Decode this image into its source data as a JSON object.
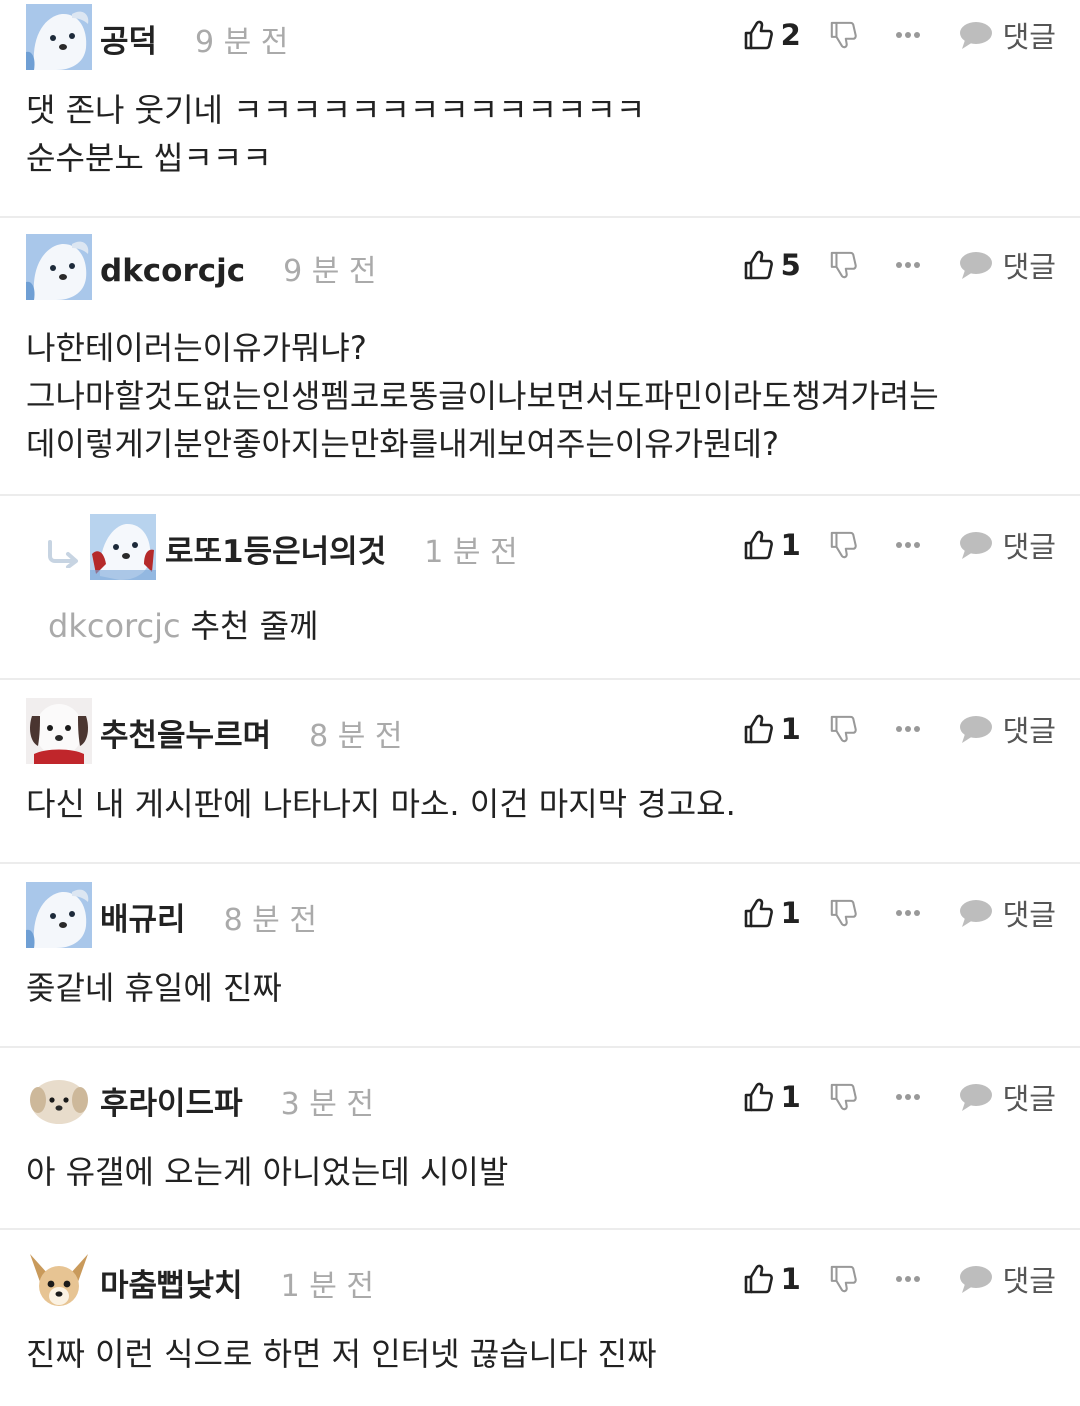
{
  "actions": {
    "reply_label": "댓글"
  },
  "comments": [
    {
      "author": "공덕",
      "time": "9 분 전",
      "likes": "2",
      "avatar": "white-dog-avatar",
      "lines": [
        "댓 존나 웃기네 ㅋㅋㅋㅋㅋㅋㅋㅋㅋㅋㅋㅋㅋㅋ",
        "순수분노 씹ㅋㅋㅋ"
      ]
    },
    {
      "author": "dkcorcjc",
      "time": "9 분 전",
      "likes": "5",
      "avatar": "white-dog-avatar",
      "lines": [
        "나한테이러는이유가뭐냐?",
        "그나마할것도없는인생펨코로똥글이나보면서도파민이라도챙겨가려는",
        "데이렇게기분안좋아지는만화를내게보여주는이유가뭔데?"
      ]
    },
    {
      "author": "로또1등은너의것",
      "time": "1 분 전",
      "likes": "1",
      "avatar": "white-dog-red-avatar",
      "reply": true,
      "mention": "dkcorcjc",
      "lines": [
        "추천 줄께"
      ]
    },
    {
      "author": "추천을누르며",
      "time": "8 분 전",
      "likes": "1",
      "avatar": "puppy-red-collar-avatar",
      "lines": [
        "다신 내 게시판에 나타나지 마소. 이건 마지막 경고요."
      ]
    },
    {
      "author": "배규리",
      "time": "8 분 전",
      "likes": "1",
      "avatar": "white-dog-avatar",
      "lines": [
        "좆같네 휴일에 진짜"
      ]
    },
    {
      "author": "후라이드파",
      "time": "3 분 전",
      "likes": "1",
      "avatar": "beige-puppy-avatar",
      "lines": [
        "아 유갤에 오는게 아니었는데 시이발"
      ]
    },
    {
      "author": "마춤뻡낮치",
      "time": "1 분 전",
      "likes": "1",
      "avatar": "chihuahua-avatar",
      "lines": [
        "진짜 이런 식으로 하면 저 인터넷 끊습니다 진짜"
      ]
    }
  ]
}
